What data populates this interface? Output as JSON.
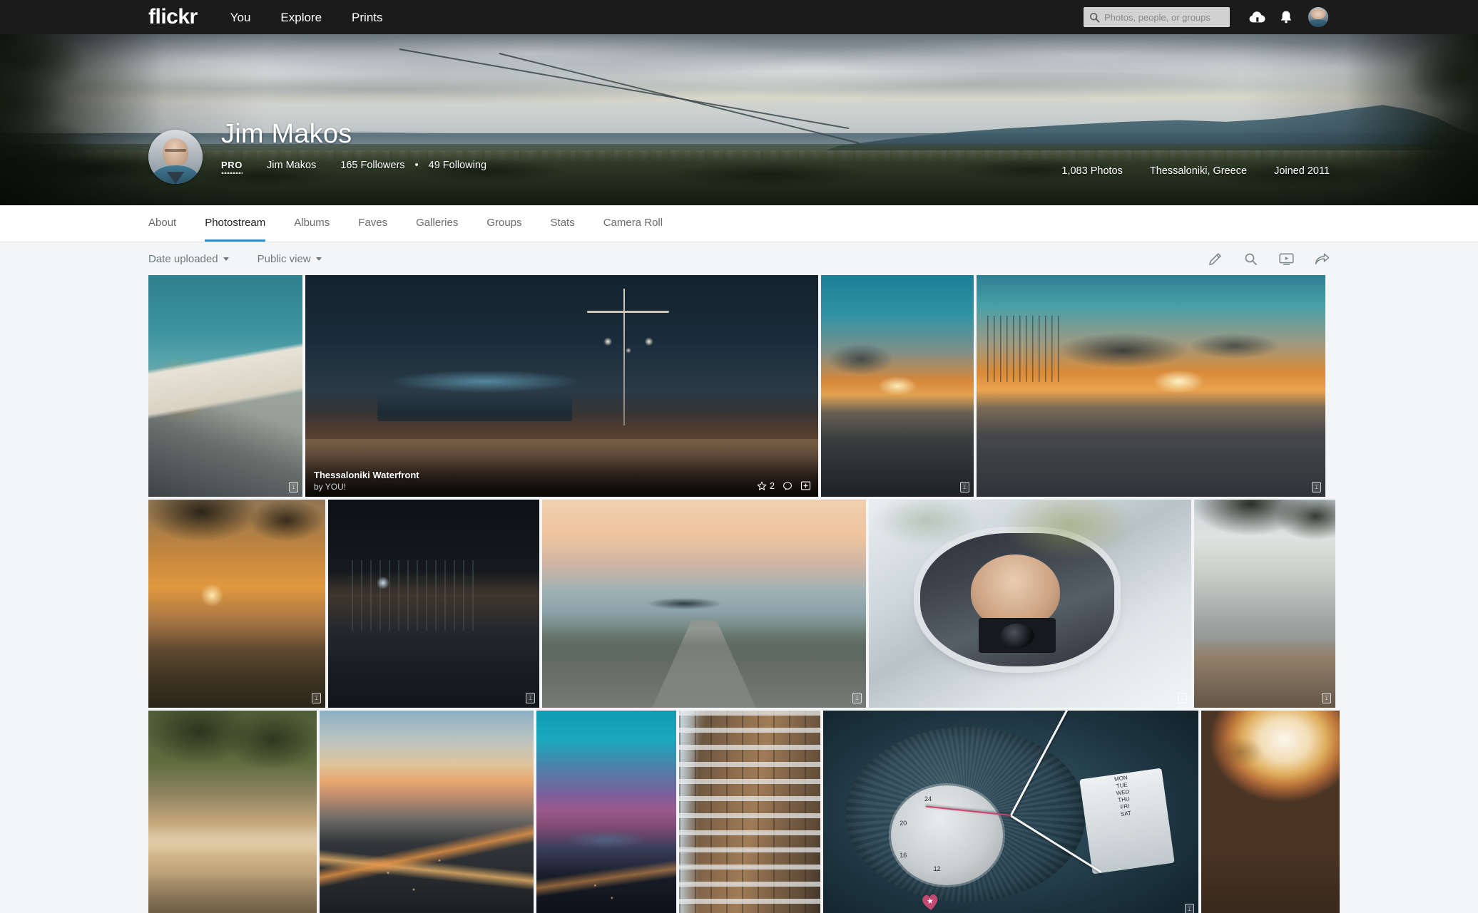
{
  "topnav": {
    "logo": "flickr",
    "links": [
      {
        "label": "You"
      },
      {
        "label": "Explore"
      },
      {
        "label": "Prints"
      }
    ],
    "search": {
      "placeholder": "Photos, people, or groups",
      "value": ""
    },
    "icons": [
      {
        "name": "upload-icon"
      },
      {
        "name": "notifications-bell-icon"
      },
      {
        "name": "account-avatar"
      }
    ]
  },
  "profile": {
    "display_name": "Jim Makos",
    "pro_badge": "PRO",
    "username": "Jim Makos",
    "followers": "165 Followers",
    "separator": "•",
    "following": "49 Following",
    "photo_count": "1,083 Photos",
    "location": "Thessaloniki, Greece",
    "joined": "Joined 2011"
  },
  "tabs": [
    {
      "label": "About",
      "active": false
    },
    {
      "label": "Photostream",
      "active": true
    },
    {
      "label": "Albums",
      "active": false
    },
    {
      "label": "Faves",
      "active": false
    },
    {
      "label": "Galleries",
      "active": false
    },
    {
      "label": "Groups",
      "active": false
    },
    {
      "label": "Stats",
      "active": false
    },
    {
      "label": "Camera Roll",
      "active": false
    }
  ],
  "filterbar": {
    "sort": "Date uploaded",
    "view": "Public view",
    "actions": [
      {
        "name": "edit-pencil-icon"
      },
      {
        "name": "search-icon"
      },
      {
        "name": "slideshow-icon"
      },
      {
        "name": "share-icon"
      }
    ]
  },
  "photos": {
    "featured": {
      "title": "Thessaloniki Waterfront",
      "byline": "by YOU!",
      "fave_count": "2"
    },
    "rows": [
      [
        {
          "alt": "greek-alley-at-dusk"
        },
        {
          "alt": "thessaloniki-waterfront-at-night"
        },
        {
          "alt": "harbour-sunset-with-pier"
        },
        {
          "alt": "marina-sunset-with-sailboats"
        }
      ],
      [
        {
          "alt": "sunset-through-tree-silhouette"
        },
        {
          "alt": "illuminated-building-at-night"
        },
        {
          "alt": "seaside-promenade-with-cyclists"
        },
        {
          "alt": "photographer-in-car-side-mirror"
        },
        {
          "alt": "wooden-pier-with-tables"
        }
      ],
      [
        {
          "alt": "cafe-street-under-trees"
        },
        {
          "alt": "coastal-highway-at-twilight"
        },
        {
          "alt": "city-lights-blue-hour"
        },
        {
          "alt": "apartment-building-facade"
        },
        {
          "alt": "wristwatch-macro-detail"
        },
        {
          "alt": "golden-hazy-landscape"
        }
      ]
    ]
  }
}
